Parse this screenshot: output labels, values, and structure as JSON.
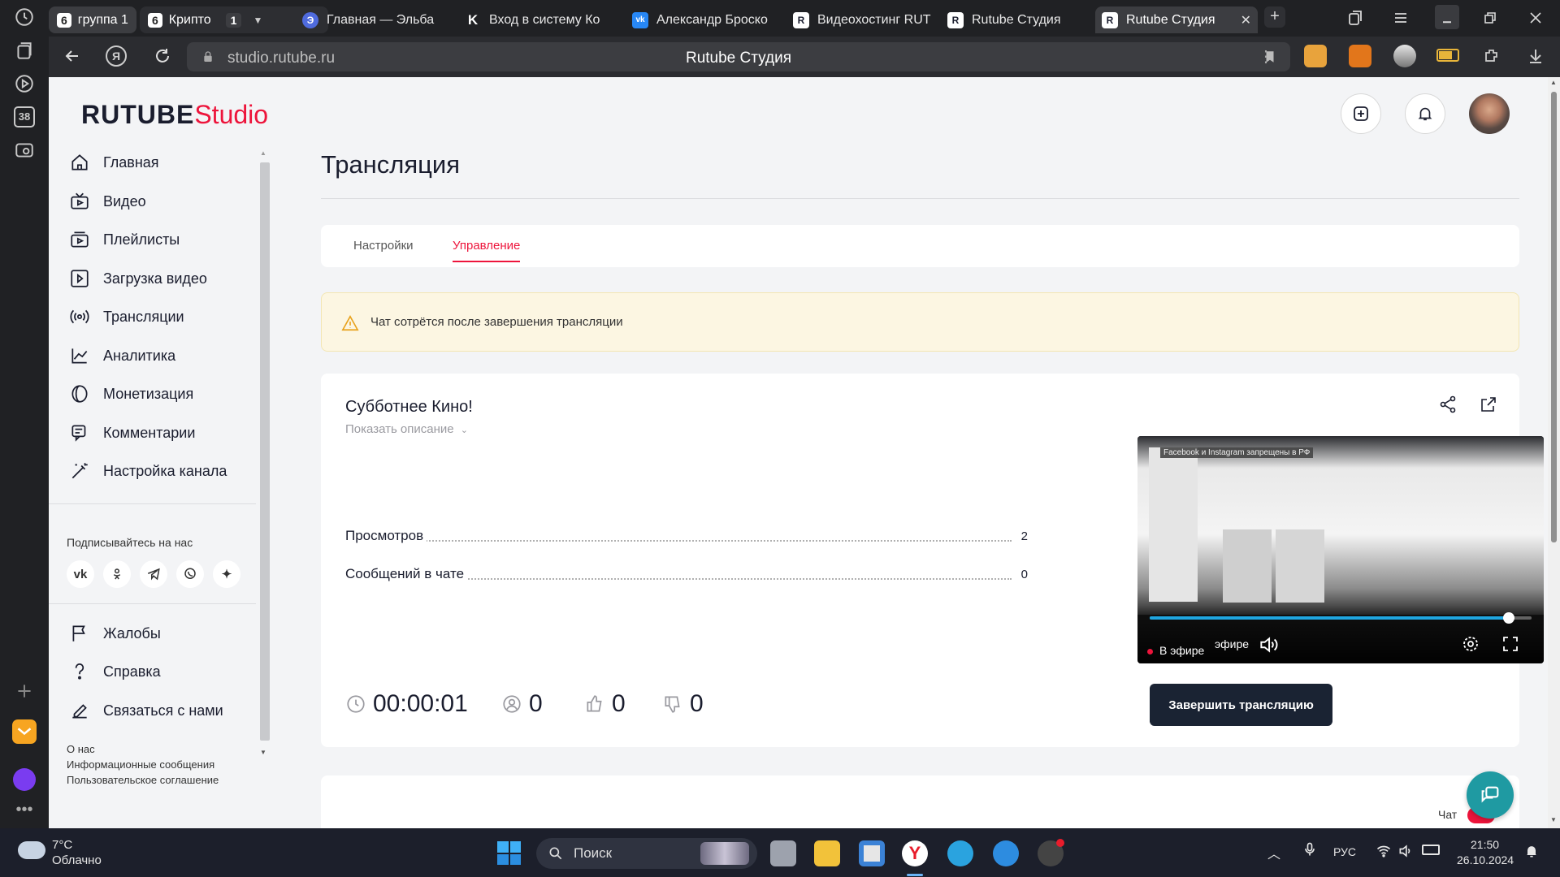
{
  "browser": {
    "tab_groups": [
      {
        "count": "6",
        "label": "группа 1"
      },
      {
        "count": "6",
        "label": "Крипто",
        "extra_count": "1"
      }
    ],
    "tabs": [
      {
        "label": "Главная — Эльба",
        "favicon": "Э"
      },
      {
        "label": "Вход в систему Ко",
        "favicon": "K"
      },
      {
        "label": "Александр Броско",
        "favicon": "vk"
      },
      {
        "label": "Видеохостинг RUT",
        "favicon": "R"
      },
      {
        "label": "Rutube Студия",
        "favicon": "R"
      },
      {
        "label": "Rutube Студия",
        "favicon": "R",
        "active": true
      }
    ],
    "url": "studio.rutube.ru",
    "page_title": "Rutube Студия",
    "rail_badge": "38"
  },
  "header": {
    "logo_main": "RUTUBE",
    "logo_sub": "Studio"
  },
  "sidebar": {
    "items": [
      {
        "label": "Главная",
        "icon": "home-icon"
      },
      {
        "label": "Видео",
        "icon": "video-icon"
      },
      {
        "label": "Плейлисты",
        "icon": "playlist-icon"
      },
      {
        "label": "Загрузка видео",
        "icon": "upload-icon"
      },
      {
        "label": "Трансляции",
        "icon": "broadcast-icon"
      },
      {
        "label": "Аналитика",
        "icon": "analytics-icon"
      },
      {
        "label": "Монетизация",
        "icon": "monetization-icon"
      },
      {
        "label": "Комментарии",
        "icon": "comments-icon"
      },
      {
        "label": "Настройка канала",
        "icon": "magic-wand-icon"
      }
    ],
    "follow_label": "Подписывайтесь на нас",
    "socials": [
      "vk",
      "ok",
      "telegram",
      "viber",
      "zen"
    ],
    "bottom_items": [
      {
        "label": "Жалобы",
        "icon": "flag-icon"
      },
      {
        "label": "Справка",
        "icon": "help-icon"
      },
      {
        "label": "Связаться с нами",
        "icon": "edit-icon"
      }
    ],
    "footer_links": [
      "О нас",
      "Информационные сообщения",
      "Пользовательское соглашение"
    ]
  },
  "main": {
    "title": "Трансляция",
    "tabs": [
      {
        "label": "Настройки",
        "active": false
      },
      {
        "label": "Управление",
        "active": true
      }
    ],
    "warning": "Чат сотрётся после завершения трансляции",
    "stream": {
      "name": "Субботнее Кино!",
      "show_description": "Показать описание",
      "stats": [
        {
          "label": "Просмотров",
          "value": "2"
        },
        {
          "label": "Сообщений в чате",
          "value": "0"
        }
      ],
      "duration": "00:00:01",
      "viewers": "0",
      "likes": "0",
      "dislikes": "0",
      "end_button": "Завершить трансляцию"
    },
    "player": {
      "overlay_banner": "Facebook и Instagram запрещены в РФ",
      "live_label": "В эфире",
      "live_label_echo": "эфире",
      "progress": 0.94
    },
    "chat_label": "Чат"
  },
  "taskbar": {
    "weather_temp": "7°C",
    "weather_desc": "Облачно",
    "search_placeholder": "Поиск",
    "lang": "РУС",
    "time": "21:50",
    "date": "26.10.2024"
  },
  "colors": {
    "accent": "#ed143b",
    "dark": "#1a2333",
    "teal": "#1f9aa2",
    "player_progress": "#1fa6e0"
  }
}
